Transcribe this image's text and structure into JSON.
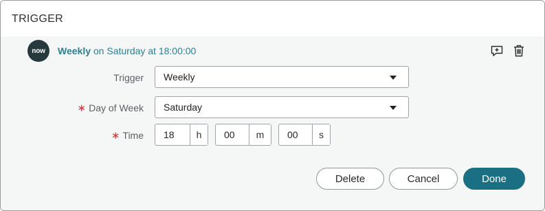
{
  "panel": {
    "title": "TRIGGER"
  },
  "logo": {
    "text": "now",
    "icon": "servicenow-logo"
  },
  "summary": {
    "frequency": "Weekly",
    "rest": " on Saturday at 18:00:00"
  },
  "actions": {
    "add_icon": "add-comment-icon",
    "delete_icon": "trash-icon"
  },
  "form": {
    "trigger": {
      "label": "Trigger",
      "value": "Weekly"
    },
    "day_of_week": {
      "label": "Day of Week",
      "value": "Saturday",
      "required": true
    },
    "time": {
      "label": "Time",
      "required": true,
      "hours": {
        "value": "18",
        "unit": "h"
      },
      "minutes": {
        "value": "00",
        "unit": "m"
      },
      "seconds": {
        "value": "00",
        "unit": "s"
      }
    },
    "required_mark": "∗"
  },
  "buttons": {
    "delete": "Delete",
    "cancel": "Cancel",
    "done": "Done"
  },
  "colors": {
    "accent": "#2d7f91",
    "primary": "#1b6f83",
    "required": "#c8383b",
    "logo_bg": "#263a3e"
  }
}
